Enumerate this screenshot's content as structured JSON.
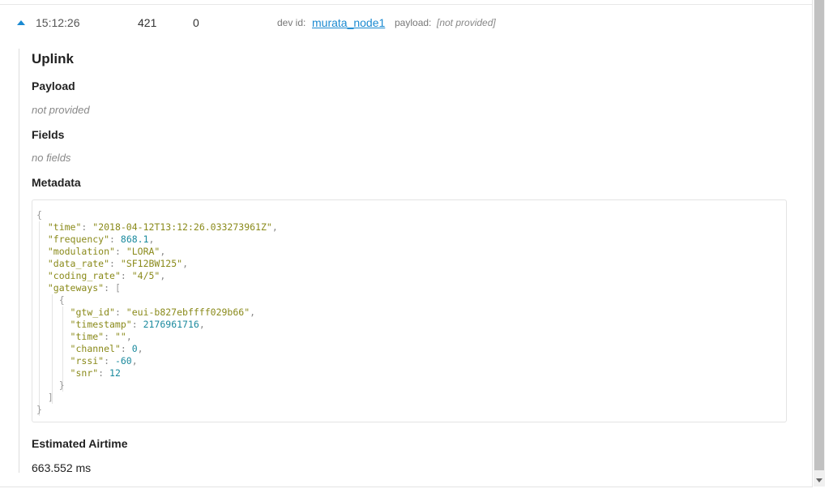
{
  "row": {
    "time": "15:12:26",
    "counter": "421",
    "port": "0",
    "dev_id_label": "dev id:",
    "dev_id": "murata_node1",
    "payload_label": "payload:",
    "payload_value": "[not provided]"
  },
  "detail": {
    "title": "Uplink",
    "payload_heading": "Payload",
    "payload_text": "not provided",
    "fields_heading": "Fields",
    "fields_text": "no fields",
    "metadata_heading": "Metadata",
    "metadata": {
      "open": "{",
      "time_key": "\"time\"",
      "time_val": "\"2018-04-12T13:12:26.033273961Z\"",
      "frequency_key": "\"frequency\"",
      "frequency_val": "868.1",
      "modulation_key": "\"modulation\"",
      "modulation_val": "\"LORA\"",
      "data_rate_key": "\"data_rate\"",
      "data_rate_val": "\"SF12BW125\"",
      "coding_rate_key": "\"coding_rate\"",
      "coding_rate_val": "\"4/5\"",
      "gateways_key": "\"gateways\"",
      "gateways_open": "[",
      "gw_open": "{",
      "gtw_id_key": "\"gtw_id\"",
      "gtw_id_val": "\"eui-b827ebffff029b66\"",
      "timestamp_key": "\"timestamp\"",
      "timestamp_val": "2176961716",
      "gw_time_key": "\"time\"",
      "gw_time_val": "\"\"",
      "channel_key": "\"channel\"",
      "channel_val": "0",
      "rssi_key": "\"rssi\"",
      "rssi_val": "-60",
      "snr_key": "\"snr\"",
      "snr_val": "12",
      "gw_close": "}",
      "gateways_close": "]",
      "close": "}"
    },
    "airtime_heading": "Estimated Airtime",
    "airtime_value": "663.552 ms"
  }
}
